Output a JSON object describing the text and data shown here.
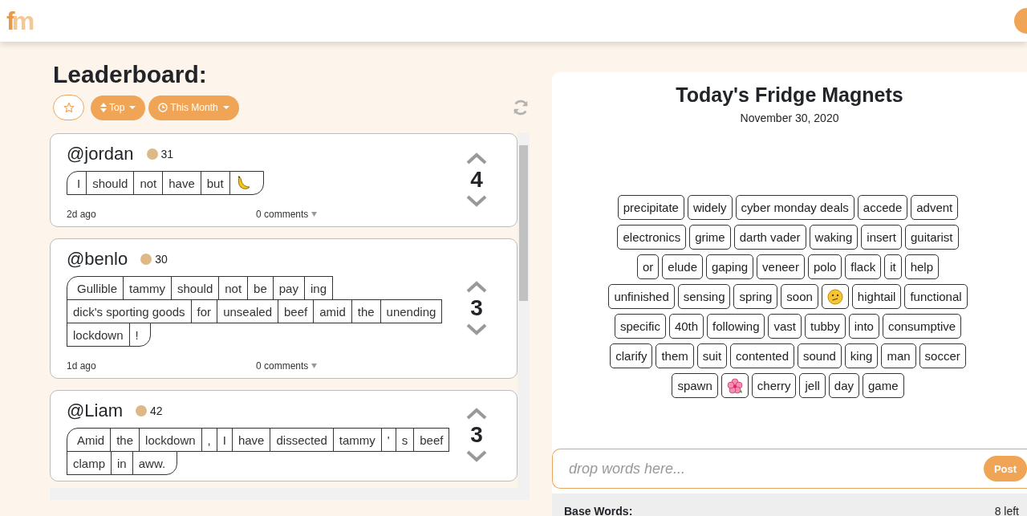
{
  "logo": {
    "first": "f",
    "second": "m"
  },
  "leaderboard": {
    "title": "Leaderboard:",
    "filters": [
      {
        "kind": "star"
      },
      {
        "kind": "sort",
        "label": "Top"
      },
      {
        "kind": "time",
        "label": "This Month"
      }
    ]
  },
  "posts": [
    {
      "user": "@jordan",
      "points": "31",
      "color": "#dfb887",
      "lines": [
        [
          {
            "kind": "word",
            "text": "I"
          },
          {
            "kind": "word",
            "text": "should"
          },
          {
            "kind": "word",
            "text": "not"
          },
          {
            "kind": "word",
            "text": "have"
          },
          {
            "kind": "word",
            "text": "but"
          },
          {
            "kind": "banana"
          }
        ]
      ],
      "votes": "4",
      "age": "2d ago",
      "comments": "0 comments"
    },
    {
      "user": "@benlo",
      "points": "30",
      "color": "#dfb887",
      "lines": [
        [
          {
            "kind": "word",
            "text": "Gullible"
          },
          {
            "kind": "word",
            "text": "tammy"
          },
          {
            "kind": "word",
            "text": "should"
          },
          {
            "kind": "word",
            "text": "not"
          },
          {
            "kind": "word",
            "text": "be"
          },
          {
            "kind": "word",
            "text": "pay"
          },
          {
            "kind": "word",
            "text": "ing"
          }
        ],
        [
          {
            "kind": "word",
            "text": "dick's sporting goods"
          },
          {
            "kind": "word",
            "text": "for"
          },
          {
            "kind": "word",
            "text": "unsealed"
          },
          {
            "kind": "word",
            "text": "beef"
          },
          {
            "kind": "word",
            "text": "amid"
          },
          {
            "kind": "word",
            "text": "the"
          },
          {
            "kind": "word",
            "text": "unending"
          }
        ],
        [
          {
            "kind": "word",
            "text": "lockdown"
          },
          {
            "kind": "word",
            "text": "!"
          }
        ]
      ],
      "votes": "3",
      "age": "1d ago",
      "comments": "0 comments"
    },
    {
      "user": "@Liam",
      "points": "42",
      "color": "#dfb887",
      "lines": [
        [
          {
            "kind": "word",
            "text": "Amid"
          },
          {
            "kind": "word",
            "text": "the"
          },
          {
            "kind": "word",
            "text": "lockdown"
          },
          {
            "kind": "word",
            "text": ","
          },
          {
            "kind": "word",
            "text": "I"
          },
          {
            "kind": "word",
            "text": "have"
          },
          {
            "kind": "word",
            "text": "dissected"
          },
          {
            "kind": "word",
            "text": "tammy"
          },
          {
            "kind": "word",
            "text": "'"
          },
          {
            "kind": "word",
            "text": "s"
          },
          {
            "kind": "word",
            "text": "beef"
          }
        ],
        [
          {
            "kind": "word",
            "text": "clamp"
          },
          {
            "kind": "word",
            "text": "in"
          },
          {
            "kind": "word",
            "text": "aww."
          }
        ]
      ],
      "votes": "3"
    }
  ],
  "magnets": {
    "title": "Today's Fridge Magnets",
    "date": "November 30, 2020",
    "tiles": [
      {
        "kind": "word",
        "text": "precipitate"
      },
      {
        "kind": "word",
        "text": "widely"
      },
      {
        "kind": "word",
        "text": "cyber monday deals"
      },
      {
        "kind": "word",
        "text": "accede"
      },
      {
        "kind": "word",
        "text": "advent"
      },
      {
        "kind": "word",
        "text": "electronics"
      },
      {
        "kind": "word",
        "text": "grime"
      },
      {
        "kind": "word",
        "text": "darth vader"
      },
      {
        "kind": "word",
        "text": "waking"
      },
      {
        "kind": "word",
        "text": "insert"
      },
      {
        "kind": "word",
        "text": "guitarist"
      },
      {
        "kind": "word",
        "text": "or"
      },
      {
        "kind": "word",
        "text": "elude"
      },
      {
        "kind": "word",
        "text": "gaping"
      },
      {
        "kind": "word",
        "text": "veneer"
      },
      {
        "kind": "word",
        "text": "polo"
      },
      {
        "kind": "word",
        "text": "flack"
      },
      {
        "kind": "word",
        "text": "it"
      },
      {
        "kind": "word",
        "text": "help"
      },
      {
        "kind": "word",
        "text": "unfinished"
      },
      {
        "kind": "word",
        "text": "sensing"
      },
      {
        "kind": "word",
        "text": "spring"
      },
      {
        "kind": "word",
        "text": "soon"
      },
      {
        "kind": "face"
      },
      {
        "kind": "word",
        "text": "hightail"
      },
      {
        "kind": "word",
        "text": "functional"
      },
      {
        "kind": "word",
        "text": "specific"
      },
      {
        "kind": "word",
        "text": "40th"
      },
      {
        "kind": "word",
        "text": "following"
      },
      {
        "kind": "word",
        "text": "vast"
      },
      {
        "kind": "word",
        "text": "tubby"
      },
      {
        "kind": "word",
        "text": "into"
      },
      {
        "kind": "word",
        "text": "consumptive"
      },
      {
        "kind": "word",
        "text": "clarify"
      },
      {
        "kind": "word",
        "text": "them"
      },
      {
        "kind": "word",
        "text": "suit"
      },
      {
        "kind": "word",
        "text": "contented"
      },
      {
        "kind": "word",
        "text": "sound"
      },
      {
        "kind": "word",
        "text": "king"
      },
      {
        "kind": "word",
        "text": "man"
      },
      {
        "kind": "word",
        "text": "soccer"
      },
      {
        "kind": "word",
        "text": "spawn"
      },
      {
        "kind": "flower"
      },
      {
        "kind": "word",
        "text": "cherry"
      },
      {
        "kind": "word",
        "text": "jell"
      },
      {
        "kind": "word",
        "text": "day"
      },
      {
        "kind": "word",
        "text": "game"
      }
    ]
  },
  "composer": {
    "placeholder": "drop words here...",
    "button": "Post"
  },
  "base_words": {
    "title": "Base Words:",
    "count": "8 left"
  }
}
